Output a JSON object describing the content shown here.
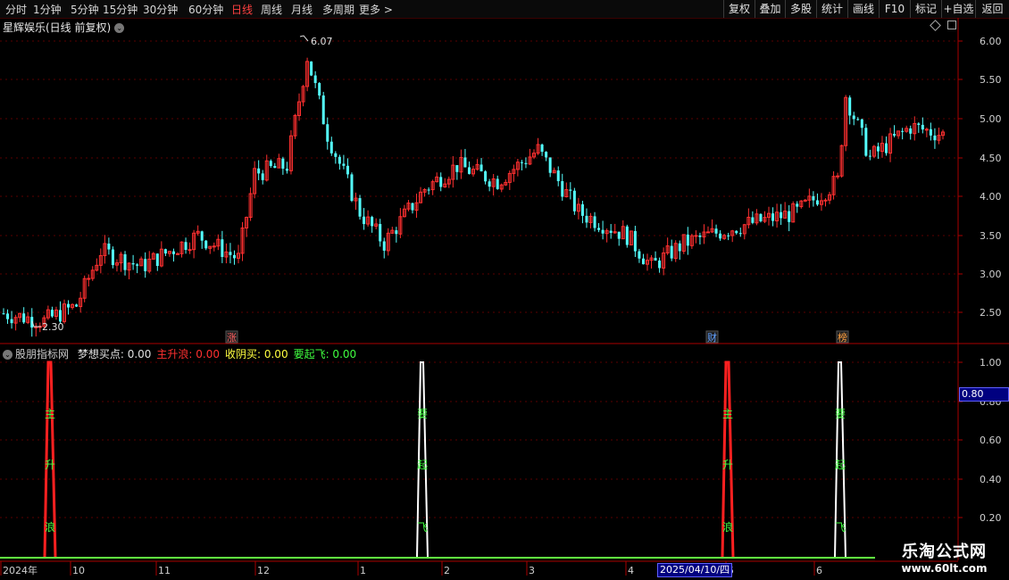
{
  "toolbar": {
    "periods": [
      "分时",
      "1分钟",
      "5分钟",
      "15分钟",
      "30分钟",
      "60分钟",
      "日线",
      "周线",
      "月线",
      "多周期",
      "更多 >"
    ],
    "active_period": "日线",
    "right_buttons": [
      "复权",
      "叠加",
      "多股",
      "统计",
      "画线",
      "F10",
      "标记",
      "+自选",
      "返回"
    ]
  },
  "stock": {
    "title": "星辉娱乐(日线 前复权)"
  },
  "price_axis": {
    "labels": [
      "6.00",
      "5.50",
      "5.00",
      "4.50",
      "4.00",
      "3.50",
      "3.00",
      "2.50"
    ]
  },
  "annotations": {
    "high_label": "6.07",
    "low_label": "2.30"
  },
  "event_badges": [
    {
      "label": "涨",
      "color": "#ff6060"
    },
    {
      "label": "财",
      "color": "#60a0ff"
    },
    {
      "label": "榜",
      "color": "#ffa040"
    }
  ],
  "indicator": {
    "name": "股朋指标网",
    "fields": [
      {
        "label": "梦想买点: 0.00",
        "color": "#e0e0e0"
      },
      {
        "label": "主升浪: 0.00",
        "color": "#ff3030"
      },
      {
        "label": "收阴买: 0.00",
        "color": "#ffff40"
      },
      {
        "label": "要起飞: 0.00",
        "color": "#40ff40"
      }
    ],
    "axis_labels": [
      "1.00",
      "0.80",
      "0.60",
      "0.40",
      "0.20"
    ],
    "current_value": "0.80",
    "spikes": [
      {
        "type": "red",
        "chars": [
          "主",
          "升",
          "浪"
        ]
      },
      {
        "type": "white",
        "chars": [
          "要",
          "起",
          "飞"
        ]
      },
      {
        "type": "red",
        "chars": [
          "主",
          "升",
          "浪"
        ]
      },
      {
        "type": "white",
        "chars": [
          "要",
          "起",
          "飞"
        ]
      }
    ]
  },
  "date_axis": {
    "labels": [
      "2024年",
      "10",
      "11",
      "12",
      "1",
      "2",
      "3",
      "4",
      "5",
      "6"
    ],
    "cursor_date": "2025/04/10/四"
  },
  "watermark": {
    "line1": "乐淘公式网",
    "line2": "www.60lt.com"
  },
  "colors": {
    "up": "#ff3030",
    "down": "#54ffff",
    "grid": "#5a0000",
    "axis": "#aa0000"
  }
}
